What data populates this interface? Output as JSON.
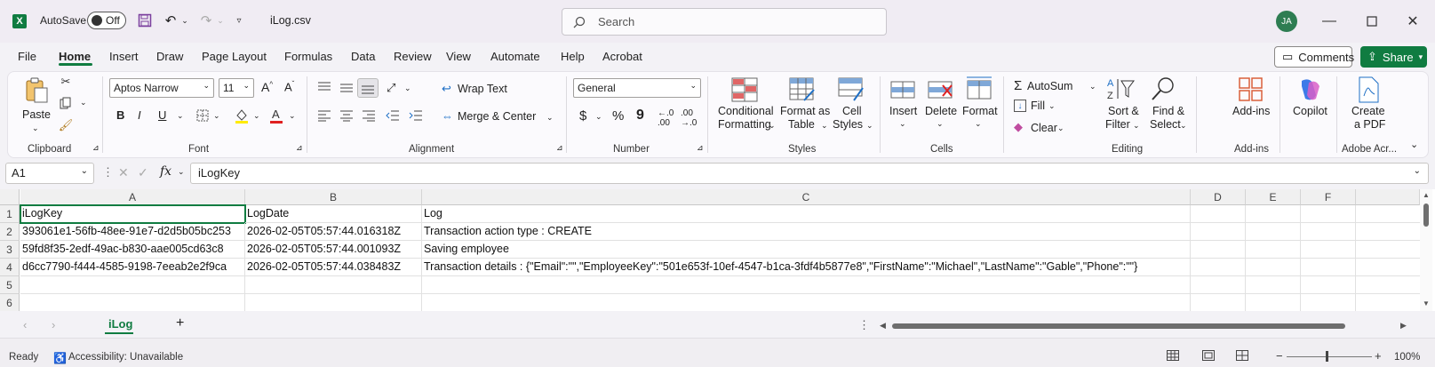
{
  "titlebar": {
    "autosave_label": "AutoSave",
    "autosave_state": "Off",
    "filename": "iLog.csv",
    "search_placeholder": "Search",
    "avatar_initials": "JA"
  },
  "menu": [
    "File",
    "Home",
    "Insert",
    "Draw",
    "Page Layout",
    "Formulas",
    "Data",
    "Review",
    "View",
    "Automate",
    "Help",
    "Acrobat"
  ],
  "menu_active": "Home",
  "actions": {
    "comments": "Comments",
    "share": "Share"
  },
  "ribbon": {
    "clipboard": {
      "label": "Clipboard",
      "paste": "Paste"
    },
    "font": {
      "label": "Font",
      "name": "Aptos Narrow",
      "size": "11"
    },
    "alignment": {
      "label": "Alignment",
      "wrap": "Wrap Text",
      "merge": "Merge & Center"
    },
    "number": {
      "label": "Number",
      "format": "General"
    },
    "styles": {
      "label": "Styles",
      "conditional_1": "Conditional",
      "conditional_2": "Formatting",
      "table_1": "Format as",
      "table_2": "Table",
      "cell_1": "Cell",
      "cell_2": "Styles"
    },
    "cells": {
      "label": "Cells",
      "insert": "Insert",
      "delete": "Delete",
      "format": "Format"
    },
    "editing": {
      "label": "Editing",
      "autosum": "AutoSum",
      "fill": "Fill",
      "clear": "Clear",
      "sort_1": "Sort &",
      "sort_2": "Filter",
      "find_1": "Find &",
      "find_2": "Select"
    },
    "addins": {
      "label": "Add-ins",
      "button": "Add-ins"
    },
    "copilot": {
      "button": "Copilot"
    },
    "acrobat": {
      "label": "Adobe Acr...",
      "create_1": "Create",
      "create_2": "a PDF"
    }
  },
  "formula_bar": {
    "name_box": "A1",
    "fx": "fx",
    "content": "iLogKey"
  },
  "grid": {
    "columns": [
      "A",
      "B",
      "C",
      "D",
      "E",
      "F"
    ],
    "rows": [
      "1",
      "2",
      "3",
      "4",
      "5",
      "6"
    ],
    "cells": [
      [
        "iLogKey",
        "LogDate",
        "Log"
      ],
      [
        "393061e1-56fb-48ee-91e7-d2d5b05bc253",
        "2026-02-05T05:57:44.016318Z",
        "Transaction action type : CREATE"
      ],
      [
        "59fd8f35-2edf-49ac-b830-aae005cd63c8",
        "2026-02-05T05:57:44.001093Z",
        "Saving employee"
      ],
      [
        "d6cc7790-f444-4585-9198-7eeab2e2f9ca",
        "2026-02-05T05:57:44.038483Z",
        "Transaction details : {\"Email\":\"\",\"EmployeeKey\":\"501e653f-10ef-4547-b1ca-3fdf4b5877e8\",\"FirstName\":\"Michael\",\"LastName\":\"Gable\",\"Phone\":\"\"}"
      ],
      [
        "",
        "",
        ""
      ],
      [
        "",
        "",
        ""
      ]
    ]
  },
  "sheet_tab": "iLog",
  "status": {
    "ready": "Ready",
    "accessibility": "Accessibility: Unavailable",
    "zoom": "100%"
  },
  "colors": {
    "accent": "#107c41"
  }
}
